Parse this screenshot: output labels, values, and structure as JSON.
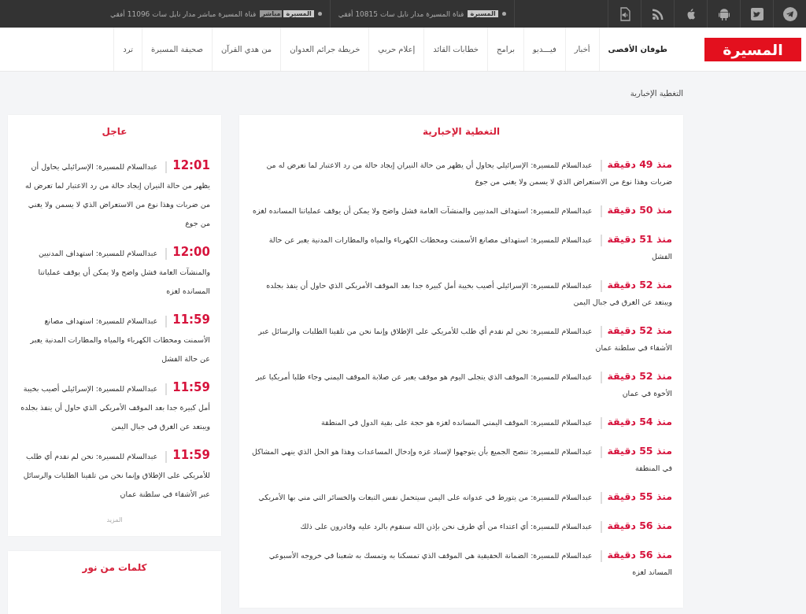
{
  "top_bar": {
    "channels": [
      {
        "logo": "المسيرة",
        "text": "قناة المسيرة مدار نايل سات 10815 أفقي"
      },
      {
        "logo": "المسيرة",
        "logo_tag": "مباشر",
        "text": "قناة المسيرة مباشر مدار نايل سات 11096 أفقي"
      }
    ]
  },
  "nav": {
    "logo": "المسيرة",
    "items": [
      {
        "label": "طوفان الأقصى",
        "selected": true
      },
      {
        "label": "أخبار",
        "selected": false
      },
      {
        "label": "فيـــديو",
        "selected": false
      },
      {
        "label": "برامج",
        "selected": false
      },
      {
        "label": "خطابات القائد",
        "selected": false
      },
      {
        "label": "إعلام حربي",
        "selected": false
      },
      {
        "label": "خريطة جرائم العدوان",
        "selected": false
      },
      {
        "label": "من هدي القرآن",
        "selected": false
      },
      {
        "label": "صحيفة المسيرة",
        "selected": false
      },
      {
        "label": "ترد",
        "selected": false
      }
    ]
  },
  "breadcrumb": "التغطية الإخبارية",
  "news_coverage": {
    "title": "التغطية الإخبارية",
    "items": [
      {
        "time": "منذ 49 دقيقة",
        "text": "عبدالسلام للمسيرة: الإسرائيلي يحاول أن يظهر من حالة النيران إيجاد حالة من رد الاعتبار لما تعرض له من ضربات وهذا نوع من الاستعراض الذي لا يسمن ولا يغني من جوع"
      },
      {
        "time": "منذ 50 دقيقة",
        "text": "عبدالسلام للمسيرة: استهداف المدنيين والمنشآت العامة فشل واضح ولا يمكن أن يوقف عملياتنا المسانده لغزه"
      },
      {
        "time": "منذ 51 دقيقة",
        "text": "عبدالسلام للمسيرة: استهداف مصانع الأسمنت ومحطات الكهرباء والمياه والمطارات المدنية يعبر عن حالة الفشل"
      },
      {
        "time": "منذ 52 دقيقة",
        "text": "عبدالسلام للمسيرة: الإسرائيلي أصيب بخيبة أمل كبيرة جدا بعد الموقف الأمريكي الذي حاول أن ينفذ بجلده ويبتعد عن الغرق في جبال اليمن"
      },
      {
        "time": "منذ 52 دقيقة",
        "text": "عبدالسلام للمسيرة: نحن لم نقدم أي طلب للأمريكي على الإطلاق وإنما نحن من تلقينا الطلبات والرسائل عبر الأشقاء في سلطنة عمان"
      },
      {
        "time": "منذ 52 دقيقة",
        "text": "عبدالسلام للمسيرة: الموقف الذي يتجلى اليوم هو موقف يعبر عن صلابة الموقف اليمني وجاء طلبا أمريكيا عبر الأخوة في عمان"
      },
      {
        "time": "منذ 54 دقيقة",
        "text": "عبدالسلام للمسيرة: الموقف اليمني المسانده لغزه هو حجة على بقية الدول في المنطقة"
      },
      {
        "time": "منذ 55 دقيقة",
        "text": "عبدالسلام للمسيرة: ننصح الجميع بأن يتوجهوا لإسناد غزه وإدخال المساعدات وهذا هو الحل الذي ينهي المشاكل في المنطقة"
      },
      {
        "time": "منذ 55 دقيقة",
        "text": "عبدالسلام للمسيرة: من يتورط في عدوانه على اليمن سيتحمل نفس التبعات والخسائر التي مني بها الأمريكي"
      },
      {
        "time": "منذ 56 دقيقة",
        "text": "عبدالسلام للمسيرة: أي اعتداء من أي طرف نحن بإذن الله سنقوم بالرد عليه وقادرون على ذلك"
      },
      {
        "time": "منذ 56 دقيقة",
        "text": "عبدالسلام للمسيرة: الضمانة الحقيقية هي الموقف الذي تمسكنا به وتمسك به شعبنا في خروجه الأسبوعي المساند لغزه"
      }
    ]
  },
  "urgent": {
    "title": "عاجل",
    "items": [
      {
        "time": "12:01",
        "text": "عبدالسلام للمسيرة: الإسرائيلي يحاول أن يظهر من حالة النيران إيجاد حالة من رد الاعتبار لما تعرض له من ضربات وهذا نوع من الاستعراض الذي لا يسمن ولا يغني من جوع"
      },
      {
        "time": "12:00",
        "text": "عبدالسلام للمسيرة: استهداف المدنيين والمنشآت العامة فشل واضح ولا يمكن أن يوقف عملياتنا المسانده لغزه"
      },
      {
        "time": "11:59",
        "text": "عبدالسلام للمسيرة: استهداف مصانع الأسمنت ومحطات الكهرباء والمياه والمطارات المدنية يعبر عن حالة الفشل"
      },
      {
        "time": "11:59",
        "text": "عبدالسلام للمسيرة: الإسرائيلي أصيب بخيبة أمل كبيرة جدا بعد الموقف الأمريكي الذي حاول أن ينفذ بجلده ويبتعد عن الغرق في جبال اليمن"
      },
      {
        "time": "11:59",
        "text": "عبدالسلام للمسيرة: نحن لم نقدم أي طلب للأمريكي على الإطلاق وإنما نحن من تلقينا الطلبات والرسائل عبر الأشقاء في سلطنة عمان"
      }
    ],
    "more": "المزيد"
  },
  "words_of_light": {
    "title": "كلمات من نور"
  }
}
